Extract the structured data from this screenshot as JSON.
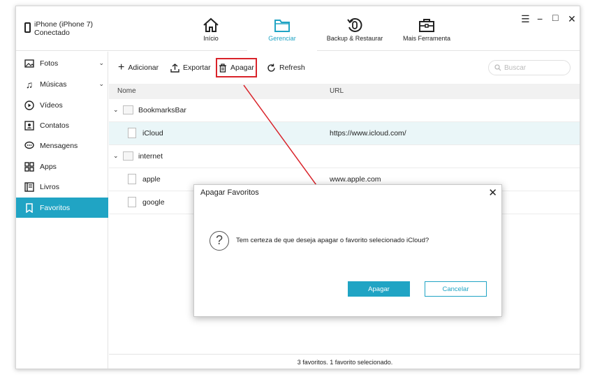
{
  "device": {
    "name": "iPhone (iPhone 7)",
    "status": "Conectado"
  },
  "nav": [
    {
      "label": "Início",
      "icon": "home-icon"
    },
    {
      "label": "Gerenciar",
      "icon": "folder-icon",
      "active": true
    },
    {
      "label": "Backup & Restaurar",
      "icon": "backup-icon"
    },
    {
      "label": "Mais Ferramenta",
      "icon": "toolbox-icon"
    }
  ],
  "window_controls": {
    "menu": "☰",
    "minimize": "−",
    "maximize": "□",
    "close": "✕"
  },
  "sidebar": {
    "items": [
      {
        "label": "Fotos",
        "icon": "photos-icon",
        "expandable": true
      },
      {
        "label": "Músicas",
        "icon": "music-icon",
        "expandable": true
      },
      {
        "label": "Vídeos",
        "icon": "video-icon"
      },
      {
        "label": "Contatos",
        "icon": "contacts-icon"
      },
      {
        "label": "Mensagens",
        "icon": "messages-icon"
      },
      {
        "label": "Apps",
        "icon": "apps-icon"
      },
      {
        "label": "Livros",
        "icon": "books-icon"
      },
      {
        "label": "Favoritos",
        "icon": "bookmark-icon",
        "active": true
      }
    ]
  },
  "toolbar": {
    "add_label": "Adicionar",
    "export_label": "Exportar",
    "delete_label": "Apagar",
    "refresh_label": "Refresh",
    "search_placeholder": "Buscar"
  },
  "table": {
    "columns": {
      "name": "Nome",
      "url": "URL"
    },
    "rows": [
      {
        "type": "folder",
        "name": "BookmarksBar",
        "url": ""
      },
      {
        "type": "file",
        "name": "iCloud",
        "url": "https://www.icloud.com/",
        "selected": true
      },
      {
        "type": "folder",
        "name": "internet",
        "url": ""
      },
      {
        "type": "file",
        "name": "apple",
        "url": "www.apple.com"
      },
      {
        "type": "file",
        "name": "google",
        "url": ""
      }
    ]
  },
  "status_text": "3 favoritos. 1 favorito selecionado.",
  "dialog": {
    "title": "Apagar Favoritos",
    "message": "Tem certeza de que deseja apagar o favorito selecionado iCloud?",
    "confirm_label": "Apagar",
    "cancel_label": "Cancelar",
    "close_glyph": "✕",
    "question_glyph": "?"
  },
  "colors": {
    "accent": "#20a4c4",
    "highlight": "#d9232a"
  }
}
